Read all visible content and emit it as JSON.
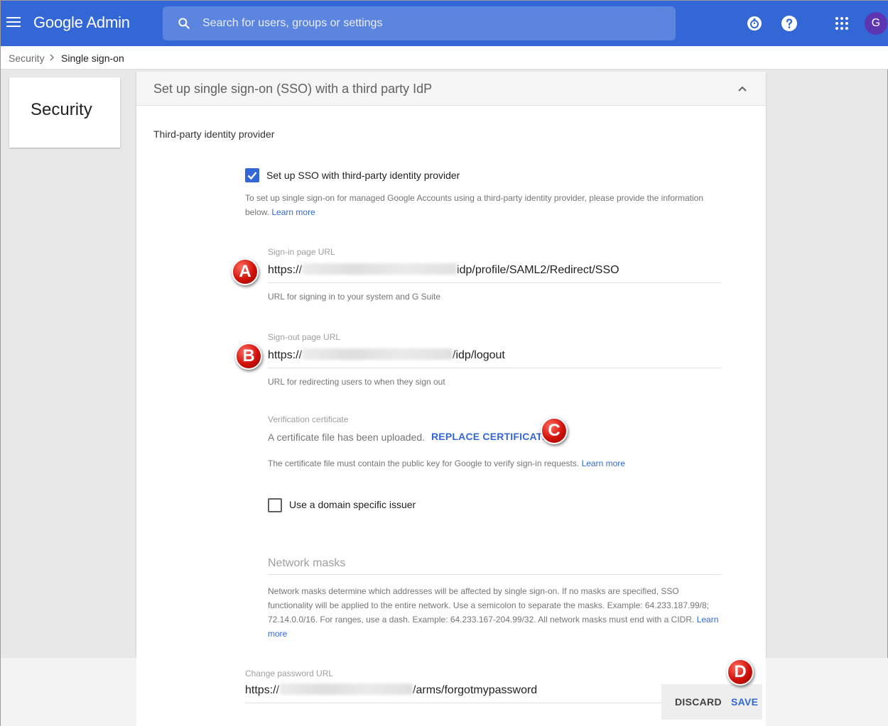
{
  "header": {
    "app_title": "Google Admin",
    "search_placeholder": "Search for users, groups or settings",
    "avatar_initial": "G",
    "icons": [
      "menu-icon",
      "search-icon",
      "timer-icon",
      "help-icon",
      "apps-grid-icon"
    ]
  },
  "breadcrumb": {
    "items": [
      "Security",
      "Single sign-on"
    ]
  },
  "sidebar_card": {
    "title": "Security"
  },
  "panel": {
    "title": "Set up single sign-on (SSO) with a third party IdP",
    "section_title": "Third-party identity provider",
    "sso_checkbox": {
      "label": "Set up SSO with third-party identity provider",
      "checked": true
    },
    "sso_help": "To set up single sign-on for managed Google Accounts using a third-party identity provider, please provide the information below.",
    "sso_help_link": "Learn more",
    "signin": {
      "label": "Sign-in page URL",
      "prefix": "https://",
      "suffix": "idp/profile/SAML2/Redirect/SSO",
      "help": "URL for signing in to your system and G Suite"
    },
    "signout": {
      "label": "Sign-out page URL",
      "prefix": "https://",
      "suffix": "/idp/logout",
      "help": "URL for redirecting users to when they sign out"
    },
    "certificate": {
      "label": "Verification certificate",
      "status": "A certificate file has been uploaded.",
      "action": "REPLACE CERTIFICATE",
      "help": "The certificate file must contain the public key for Google to verify sign-in requests.",
      "help_link": "Learn more"
    },
    "issuer_checkbox": {
      "label": "Use a domain specific issuer",
      "checked": false
    },
    "network_masks": {
      "placeholder": "Network masks",
      "help": "Network masks determine which addresses will be affected by single sign-on. If no masks are specified, SSO functionality will be applied to the entire network. Use a semicolon to separate the masks. Example: 64.233.187.99/8; 72.14.0.0/16. For ranges, use a dash. Example: 64.233.167-204.99/32. All network masks must end with a CIDR.",
      "help_link": "Learn more"
    },
    "change_password": {
      "label": "Change password URL",
      "prefix": "https://",
      "suffix": "/arms/forgotmypassword"
    }
  },
  "actions": {
    "discard": "DISCARD",
    "save": "SAVE"
  },
  "markers": {
    "a": "A",
    "b": "B",
    "c": "C",
    "d": "D",
    "color": "#d0110a"
  },
  "colors": {
    "topbar": "#3367d6",
    "link": "#3367d6"
  }
}
